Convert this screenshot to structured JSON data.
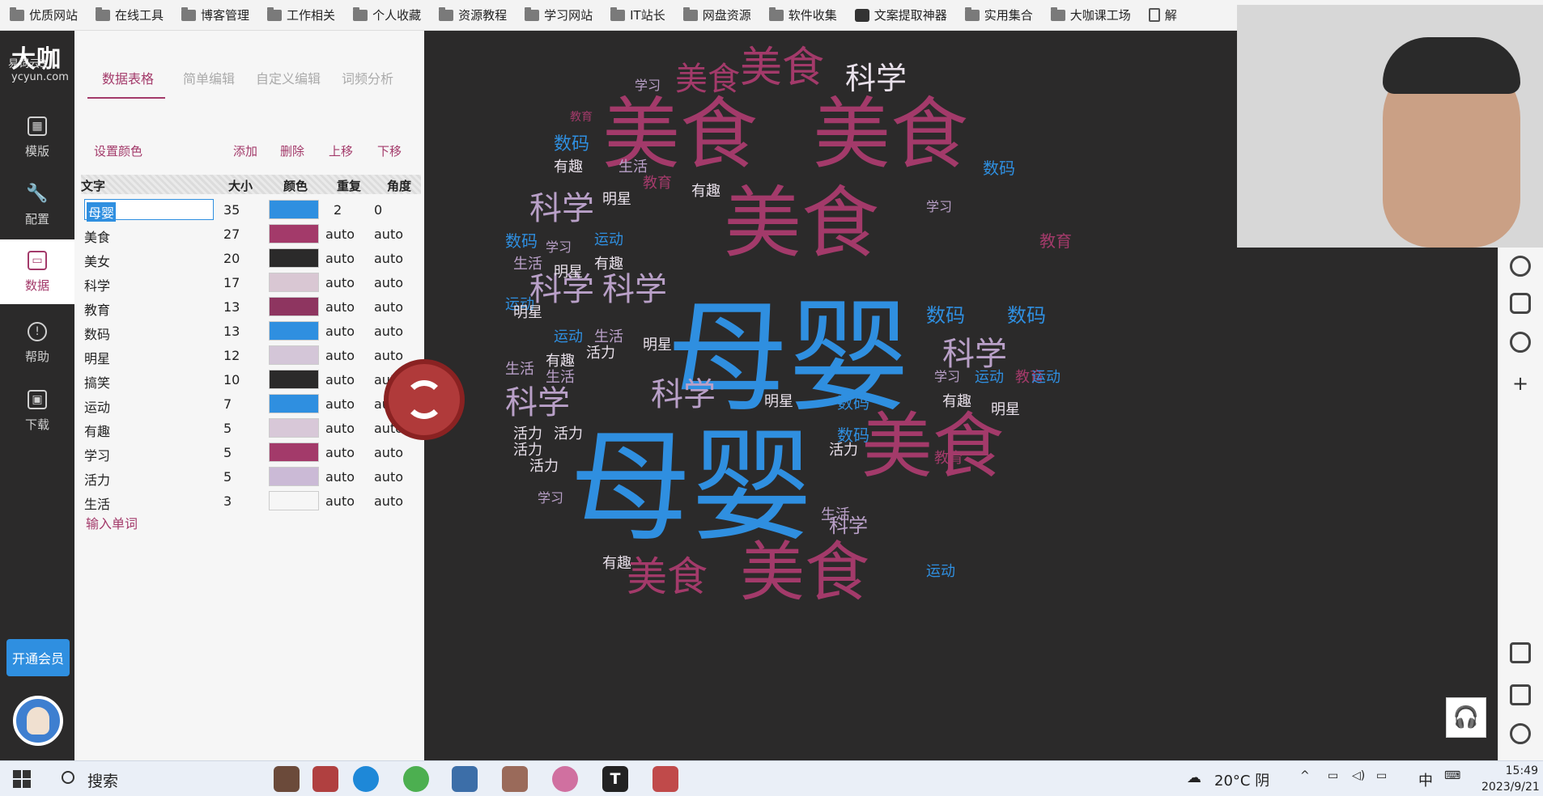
{
  "bookmarks": [
    "优质网站",
    "在线工具",
    "博客管理",
    "工作相关",
    "个人收藏",
    "资源教程",
    "学习网站",
    "IT站长",
    "网盘资源",
    "软件收集",
    "文案提取神器",
    "实用集合",
    "大咖课工场",
    "解"
  ],
  "logo": {
    "title": "大咖",
    "sub": "易词云3",
    "url": "ycyun.com"
  },
  "rail": {
    "template": "模版",
    "config": "配置",
    "data": "数据",
    "help": "帮助",
    "download": "下载",
    "vip": "开通会员"
  },
  "tabs": [
    "数据表格",
    "简单编辑",
    "自定义编辑",
    "词频分析"
  ],
  "toolbar": {
    "set_color": "设置颜色",
    "add": "添加",
    "delete": "删除",
    "move_up": "上移",
    "move_down": "下移"
  },
  "columns": {
    "word": "文字",
    "size": "大小",
    "color": "颜色",
    "repeat": "重复",
    "angle": "角度"
  },
  "rows": [
    {
      "word": "母婴",
      "size": "35",
      "color": "#2f8fe0",
      "repeat": "2",
      "angle": "0"
    },
    {
      "word": "美食",
      "size": "27",
      "color": "#a33a6a",
      "repeat": "auto",
      "angle": "auto"
    },
    {
      "word": "美女",
      "size": "20",
      "color": "#2b2a2a",
      "repeat": "auto",
      "angle": "auto"
    },
    {
      "word": "科学",
      "size": "17",
      "color": "#d9c7d3",
      "repeat": "auto",
      "angle": "auto"
    },
    {
      "word": "教育",
      "size": "13",
      "color": "#8e3560",
      "repeat": "auto",
      "angle": "auto"
    },
    {
      "word": "数码",
      "size": "13",
      "color": "#2f8fe0",
      "repeat": "auto",
      "angle": "auto"
    },
    {
      "word": "明星",
      "size": "12",
      "color": "#d4c6d8",
      "repeat": "auto",
      "angle": "auto"
    },
    {
      "word": "搞笑",
      "size": "10",
      "color": "#2b2a2a",
      "repeat": "auto",
      "angle": "auto"
    },
    {
      "word": "运动",
      "size": "7",
      "color": "#2f8fe0",
      "repeat": "auto",
      "angle": "auto"
    },
    {
      "word": "有趣",
      "size": "5",
      "color": "#d8c8d8",
      "repeat": "auto",
      "angle": "auto"
    },
    {
      "word": "学习",
      "size": "5",
      "color": "#a33a6a",
      "repeat": "auto",
      "angle": "auto"
    },
    {
      "word": "活力",
      "size": "5",
      "color": "#cbbad6",
      "repeat": "auto",
      "angle": "auto"
    },
    {
      "word": "生活",
      "size": "3",
      "color": "#f6f6f6",
      "repeat": "auto",
      "angle": "auto"
    }
  ],
  "add_word": "输入单词",
  "taskbar": {
    "search": "搜索",
    "weather": "20°C 阴",
    "ime": "中",
    "time": "15:49",
    "date": "2023/9/21"
  },
  "cloud_words": [
    "母婴",
    "母婴",
    "美食",
    "美食",
    "美食",
    "美食",
    "美食",
    "美食",
    "美食",
    "美食",
    "科学",
    "科学",
    "科学",
    "科学",
    "科学",
    "科学",
    "科学",
    "科学",
    "数码",
    "数码",
    "数码",
    "数码",
    "数码",
    "数码",
    "数码",
    "教育",
    "教育",
    "教育",
    "教育",
    "教育",
    "运动",
    "运动",
    "运动",
    "运动",
    "运动",
    "运动",
    "明星",
    "明星",
    "明星",
    "明星",
    "明星",
    "明星",
    "有趣",
    "有趣",
    "有趣",
    "有趣",
    "有趣",
    "有趣",
    "生活",
    "生活",
    "生活",
    "生活",
    "生活",
    "生活",
    "活力",
    "活力",
    "活力",
    "活力",
    "活力",
    "活力",
    "学习",
    "学习",
    "学习",
    "学习",
    "学习"
  ]
}
